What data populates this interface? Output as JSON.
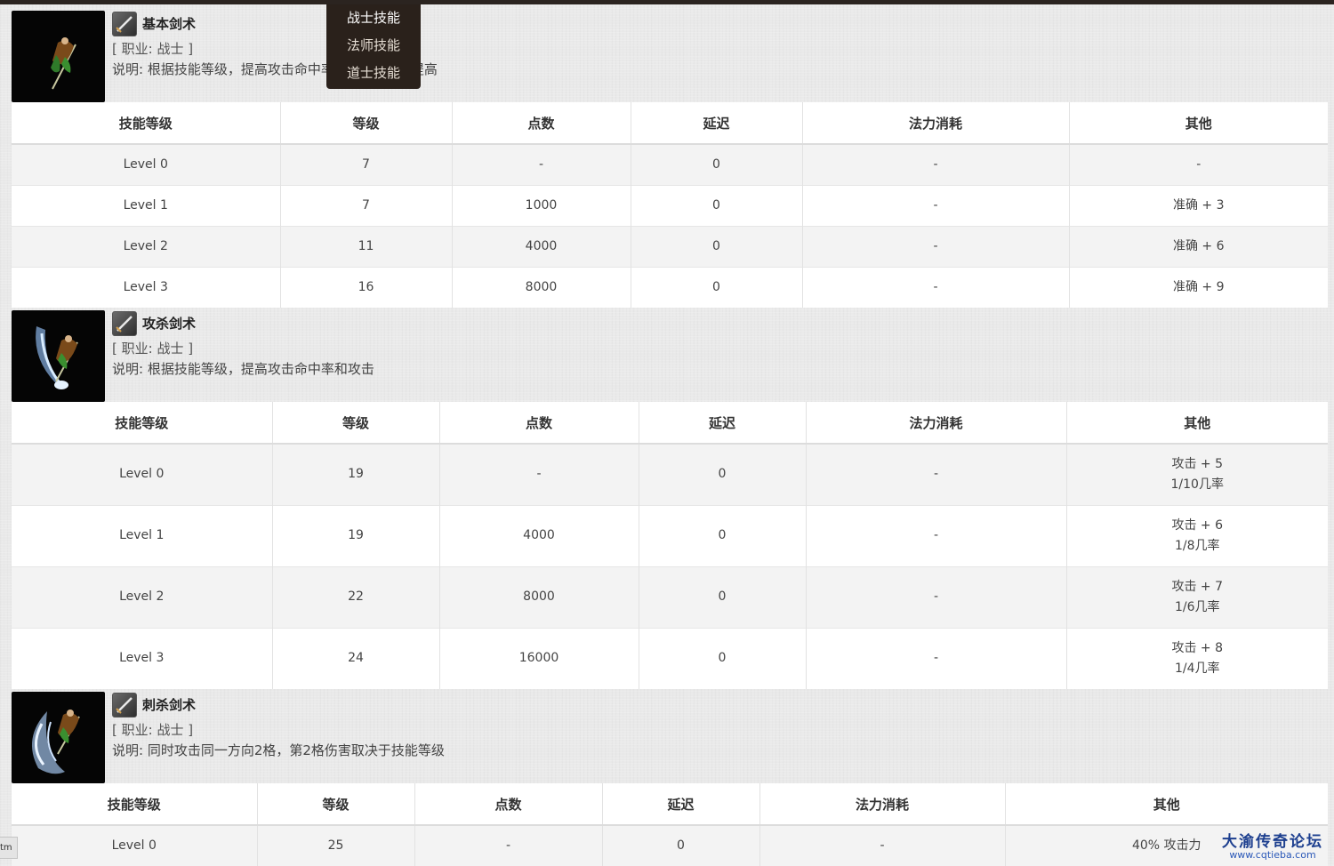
{
  "menu": [
    "战士技能",
    "法师技能",
    "道士技能"
  ],
  "skills": [
    {
      "name": "基本剑术",
      "job": "[ 职业: 战士 ]",
      "desc": "说明: 根据技能等级，提高攻击命中率",
      "desc_tail": "将会得到提高",
      "headers": [
        "技能等级",
        "等级",
        "点数",
        "延迟",
        "法力消耗",
        "其他"
      ],
      "rows": [
        [
          "Level 0",
          "7",
          "-",
          "0",
          "-",
          "-"
        ],
        [
          "Level 1",
          "7",
          "1000",
          "0",
          "-",
          "准确 + 3"
        ],
        [
          "Level 2",
          "11",
          "4000",
          "0",
          "-",
          "准确 + 6"
        ],
        [
          "Level 3",
          "16",
          "8000",
          "0",
          "-",
          "准确 + 9"
        ]
      ]
    },
    {
      "name": "攻杀剑术",
      "job": "[ 职业: 战士 ]",
      "desc": "说明: 根据技能等级，提高攻击命中率和攻击",
      "headers": [
        "技能等级",
        "等级",
        "点数",
        "延迟",
        "法力消耗",
        "其他"
      ],
      "rows": [
        [
          "Level 0",
          "19",
          "-",
          "0",
          "-",
          "攻击 + 5",
          "1/10几率"
        ],
        [
          "Level 1",
          "19",
          "4000",
          "0",
          "-",
          "攻击 + 6",
          "1/8几率"
        ],
        [
          "Level 2",
          "22",
          "8000",
          "0",
          "-",
          "攻击 + 7",
          "1/6几率"
        ],
        [
          "Level 3",
          "24",
          "16000",
          "0",
          "-",
          "攻击 + 8",
          "1/4几率"
        ]
      ]
    },
    {
      "name": "刺杀剑术",
      "job": "[ 职业: 战士 ]",
      "desc": "说明: 同时攻击同一方向2格，第2格伤害取决于技能等级",
      "headers": [
        "技能等级",
        "等级",
        "点数",
        "延迟",
        "法力消耗",
        "其他"
      ],
      "rows": [
        [
          "Level 0",
          "25",
          "-",
          "0",
          "-",
          "40% 攻击力"
        ]
      ]
    }
  ],
  "status_tab": "tm",
  "watermark": {
    "title": "大渝传奇论坛",
    "url": "www.cqtieba.com"
  }
}
